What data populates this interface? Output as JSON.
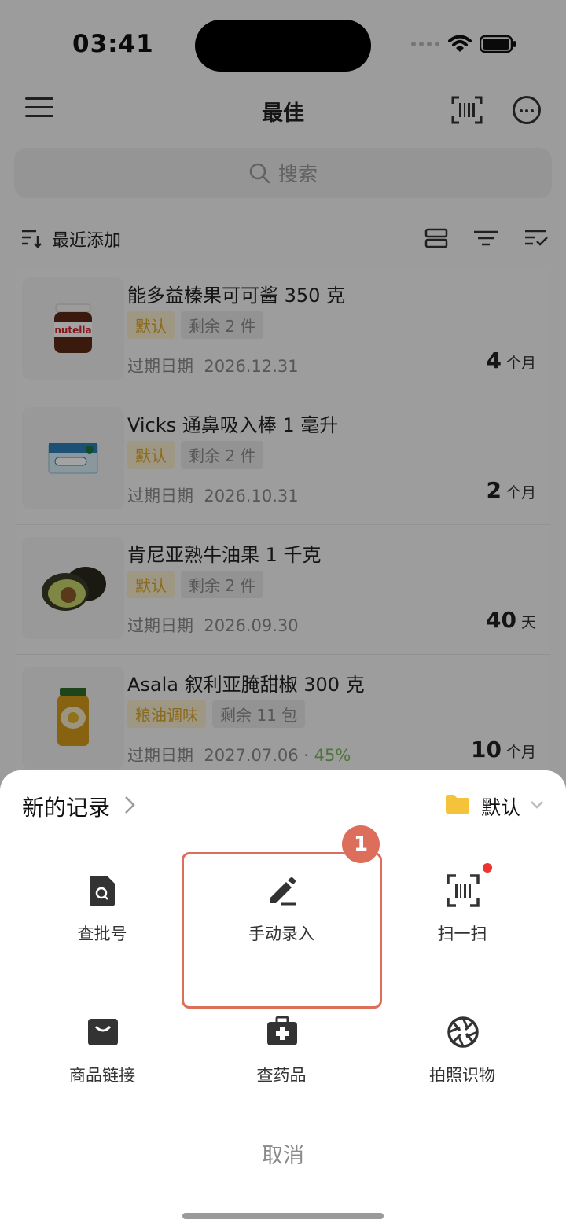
{
  "status": {
    "time": "03:41"
  },
  "header": {
    "title": "最佳"
  },
  "search": {
    "placeholder": "搜索"
  },
  "sort": {
    "label": "最近添加"
  },
  "items": [
    {
      "name": "能多益榛果可可酱 350 克",
      "category": "默认",
      "quantity": "剩余 2 件",
      "expiry_label": "过期日期",
      "expiry": "2026.12.31",
      "progress_pct": "",
      "remain_value": "4",
      "remain_unit": "个月",
      "image": "nutella-jar"
    },
    {
      "name": "Vicks 通鼻吸入棒 1 毫升",
      "category": "默认",
      "quantity": "剩余 2 件",
      "expiry_label": "过期日期",
      "expiry": "2026.10.31",
      "progress_pct": "",
      "remain_value": "2",
      "remain_unit": "个月",
      "image": "vicks-inhaler-box"
    },
    {
      "name": "肯尼亚熟牛油果 1 千克",
      "category": "默认",
      "quantity": "剩余 2 件",
      "expiry_label": "过期日期",
      "expiry": "2026.09.30",
      "progress_pct": "",
      "remain_value": "40",
      "remain_unit": "天",
      "image": "avocados"
    },
    {
      "name": "Asala 叙利亚腌甜椒 300 克",
      "category": "粮油调味",
      "quantity": "剩余 11 包",
      "expiry_label": "过期日期",
      "expiry": "2027.07.06",
      "progress_pct": "45%",
      "remain_value": "10",
      "remain_unit": "个月",
      "image": "pickled-pepper-jar"
    }
  ],
  "sheet": {
    "title": "新的记录",
    "folder": "默认",
    "actions": {
      "batch": "查批号",
      "manual": "手动录入",
      "scan": "扫一扫",
      "link": "商品链接",
      "medicine": "查药品",
      "photo": "拍照识物"
    },
    "cancel": "取消",
    "step_number": "1"
  },
  "colors": {
    "highlight": "#dd6e5b",
    "category_tag": "#d9a62b",
    "folder": "#f5c33b",
    "progress_text": "#79b85a",
    "badge_dot": "#ee3333"
  }
}
